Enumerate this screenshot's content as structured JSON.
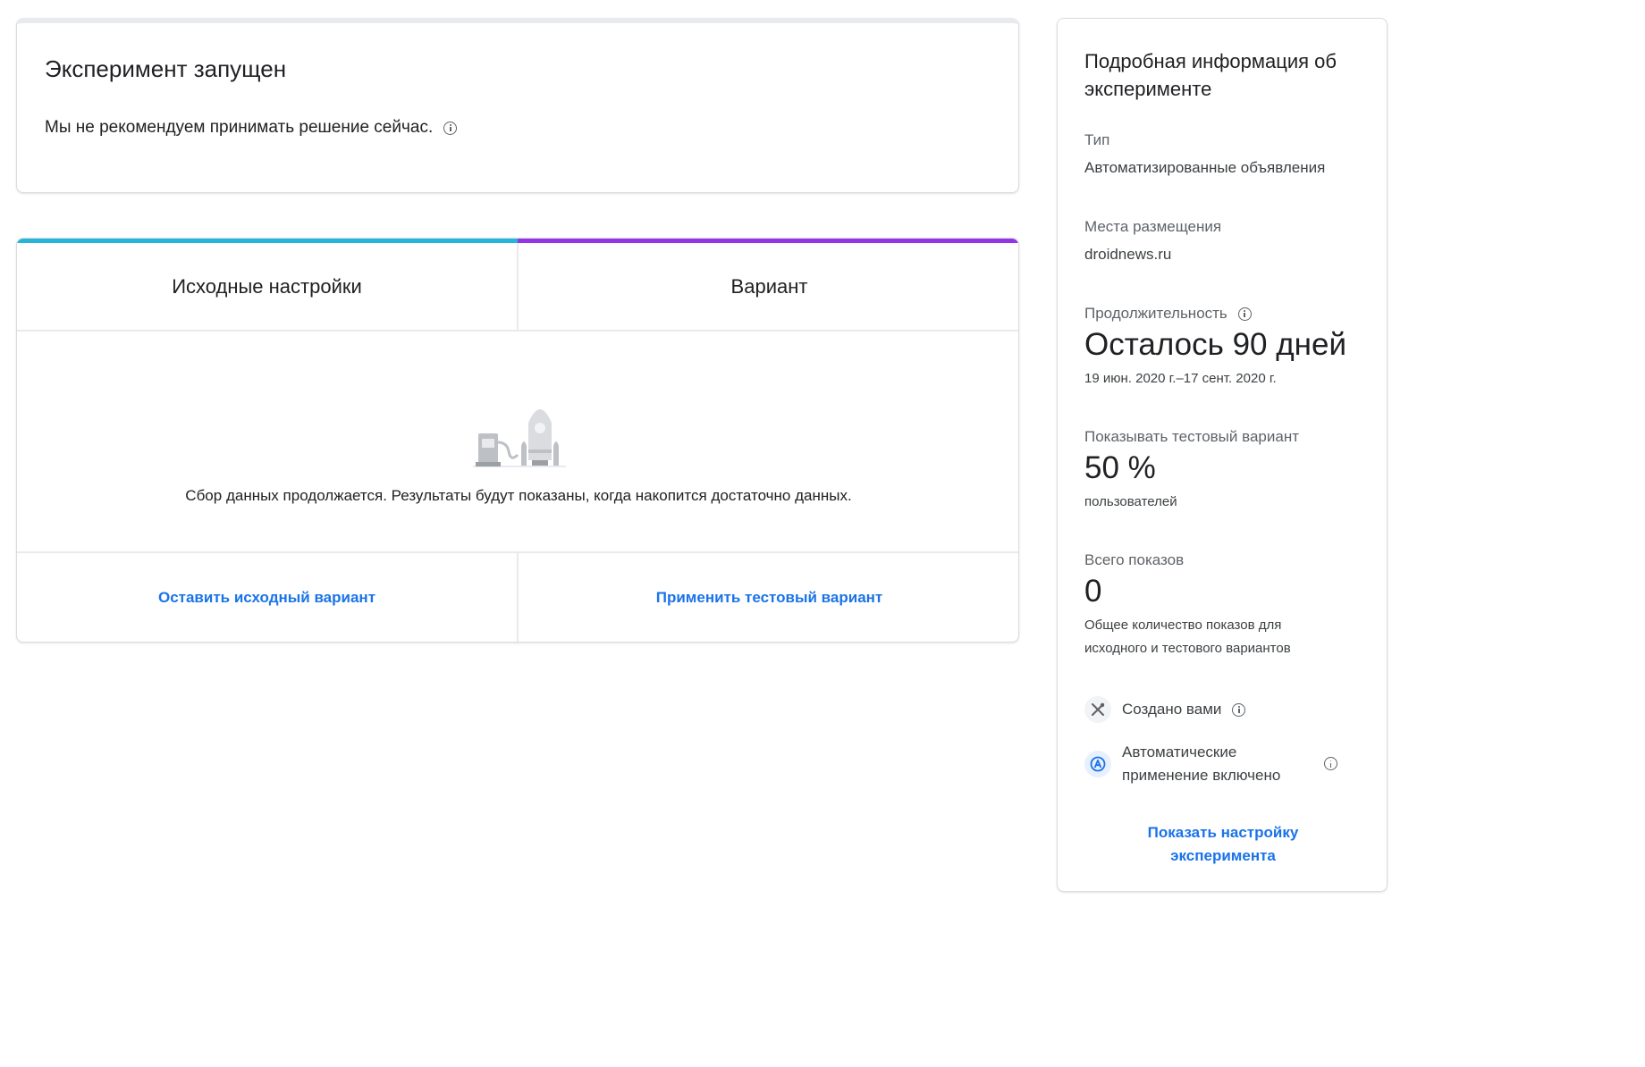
{
  "status": {
    "title": "Эксперимент запущен",
    "message": "Мы не рекомендуем принимать решение сейчас."
  },
  "comparison": {
    "baseline_label": "Исходные настройки",
    "variant_label": "Вариант",
    "baseline_color": "#26b5d9",
    "variant_color": "#9334e6",
    "collecting_message": "Сбор данных продолжается. Результаты будут показаны, когда накопится достаточно данных.",
    "illustration_icon": "rocket-launch-illustration",
    "keep_original_label": "Оставить исходный вариант",
    "apply_variant_label": "Применить тестовый вариант"
  },
  "details": {
    "title": "Подробная информация об эксперименте",
    "type_label": "Тип",
    "type_value": "Автоматизированные объявления",
    "placements_label": "Места размещения",
    "placements_value": "droidnews.ru",
    "duration_label": "Продолжительность",
    "duration_value": "Осталось 90 дней",
    "duration_range": "19 июн. 2020 г.–17 сент. 2020 г.",
    "show_variant_label": "Показывать тестовый вариант",
    "show_variant_value": "50 %",
    "show_variant_unit": "пользователей",
    "impressions_label": "Всего показов",
    "impressions_value": "0",
    "impressions_desc_line1": "Общее количество показов для",
    "impressions_desc_line2": "исходного и тестового вариантов",
    "created_by": "Создано вами",
    "created_by_icon": "tools-icon",
    "auto_apply_line1": "Автоматические",
    "auto_apply_line2": "применение включено",
    "auto_apply_icon": "auto-a-icon",
    "show_setup_line1": "Показать настройку",
    "show_setup_line2": "эксперимента",
    "link_color": "#1a73e8"
  }
}
